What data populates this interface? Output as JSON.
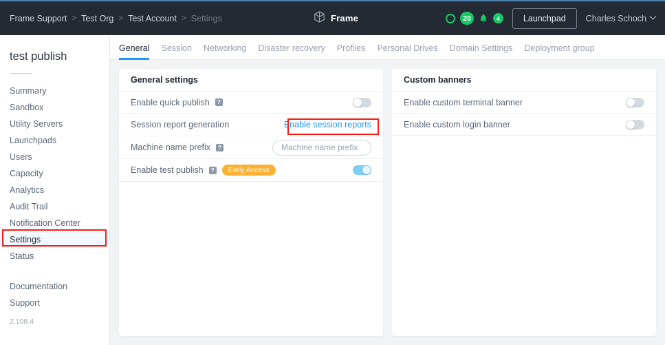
{
  "topbar": {
    "breadcrumb": [
      {
        "label": "Frame Support",
        "muted": false
      },
      {
        "label": "Test Org",
        "muted": false
      },
      {
        "label": "Test Account",
        "muted": false
      },
      {
        "label": "Settings",
        "muted": true
      }
    ],
    "separator": ">",
    "brand": {
      "name": "Frame",
      "icon": "cube-icon"
    },
    "status_ring_icon": "circle-outline-icon",
    "status_count": "20",
    "bell_icon": "bell-icon",
    "notification_count": "4",
    "launchpad_label": "Launchpad",
    "user_name": "Charles Schoch",
    "user_chevron_icon": "chevron-down-icon"
  },
  "sidebar": {
    "title": "test publish",
    "items": [
      {
        "label": "Summary",
        "active": false
      },
      {
        "label": "Sandbox",
        "active": false
      },
      {
        "label": "Utility Servers",
        "active": false
      },
      {
        "label": "Launchpads",
        "active": false
      },
      {
        "label": "Users",
        "active": false
      },
      {
        "label": "Capacity",
        "active": false
      },
      {
        "label": "Analytics",
        "active": false
      },
      {
        "label": "Audit Trail",
        "active": false
      },
      {
        "label": "Notification Center",
        "active": false
      },
      {
        "label": "Settings",
        "active": true
      },
      {
        "label": "Status",
        "active": false
      }
    ],
    "secondary_items": [
      {
        "label": "Documentation"
      },
      {
        "label": "Support"
      }
    ],
    "version": "2.108.4"
  },
  "tabs": [
    {
      "label": "General",
      "active": true
    },
    {
      "label": "Session",
      "active": false
    },
    {
      "label": "Networking",
      "active": false
    },
    {
      "label": "Disaster recovery",
      "active": false
    },
    {
      "label": "Profiles",
      "active": false
    },
    {
      "label": "Personal Drives",
      "active": false
    },
    {
      "label": "Domain Settings",
      "active": false
    },
    {
      "label": "Deployment group",
      "active": false
    }
  ],
  "general_settings": {
    "title": "General settings",
    "rows": {
      "quick_publish": {
        "label": "Enable quick publish",
        "help": "?",
        "toggle_state": "off"
      },
      "session_report": {
        "label": "Session report generation",
        "link_label": "Enable session reports"
      },
      "machine_prefix": {
        "label": "Machine name prefix",
        "help": "?",
        "input_placeholder": "Machine name prefix",
        "input_value": ""
      },
      "test_publish": {
        "label": "Enable test publish",
        "help": "?",
        "badge": "Early Access",
        "toggle_state": "on"
      }
    }
  },
  "custom_banners": {
    "title": "Custom banners",
    "rows": {
      "terminal_banner": {
        "label": "Enable custom terminal banner",
        "toggle_state": "off"
      },
      "login_banner": {
        "label": "Enable custom login banner",
        "toggle_state": "off"
      }
    }
  },
  "colors": {
    "accent_blue": "#2196f3",
    "annotation_red": "#f61e12",
    "badge_green": "#17c964",
    "early_access_orange": "#fcb034",
    "topbar_dark": "#242a33"
  }
}
